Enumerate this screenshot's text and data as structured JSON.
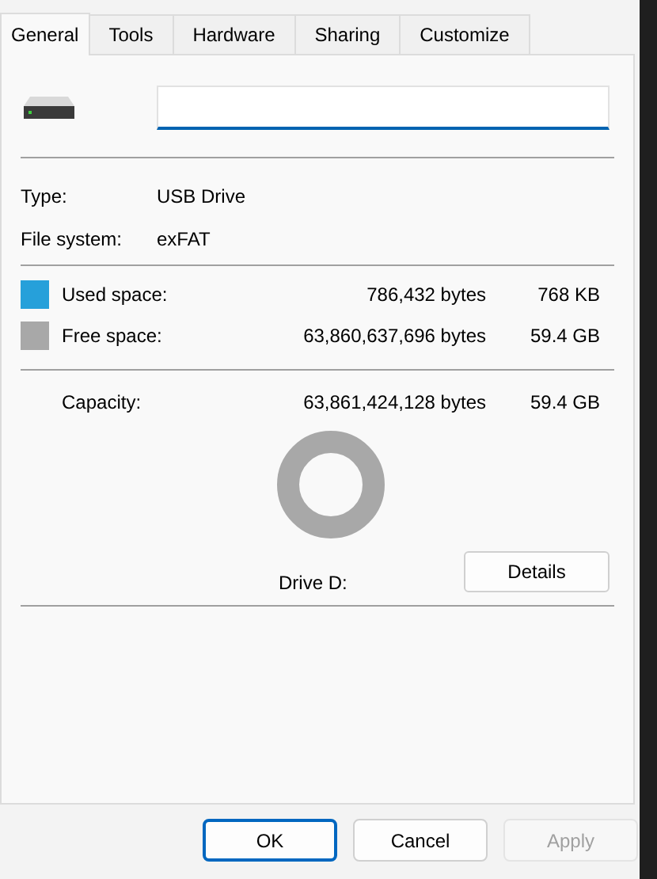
{
  "tabs": [
    {
      "label": "General",
      "selected": true
    },
    {
      "label": "Tools",
      "selected": false
    },
    {
      "label": "Hardware",
      "selected": false
    },
    {
      "label": "Sharing",
      "selected": false
    },
    {
      "label": "Customize",
      "selected": false
    }
  ],
  "properties": [
    {
      "label": "Type:",
      "value": "USB Drive"
    },
    {
      "label": "File system:",
      "value": "exFAT"
    }
  ],
  "space": [
    {
      "label": "Used space:",
      "bytes": "786,432 bytes",
      "size": "768 KB",
      "color": "#26a0da"
    },
    {
      "label": "Free space:",
      "bytes": "63,860,637,696 bytes",
      "size": "59.4 GB",
      "color": "#a8a8a8"
    }
  ],
  "capacity": {
    "label": "Capacity:",
    "bytes": "63,861,424,128 bytes",
    "size": "59.4 GB"
  },
  "drive_label": "Drive D:",
  "details_button": "Details",
  "buttons": [
    {
      "label": "OK",
      "kind": "default"
    },
    {
      "label": "Cancel",
      "kind": "normal"
    },
    {
      "label": "Apply",
      "kind": "disabled"
    }
  ]
}
